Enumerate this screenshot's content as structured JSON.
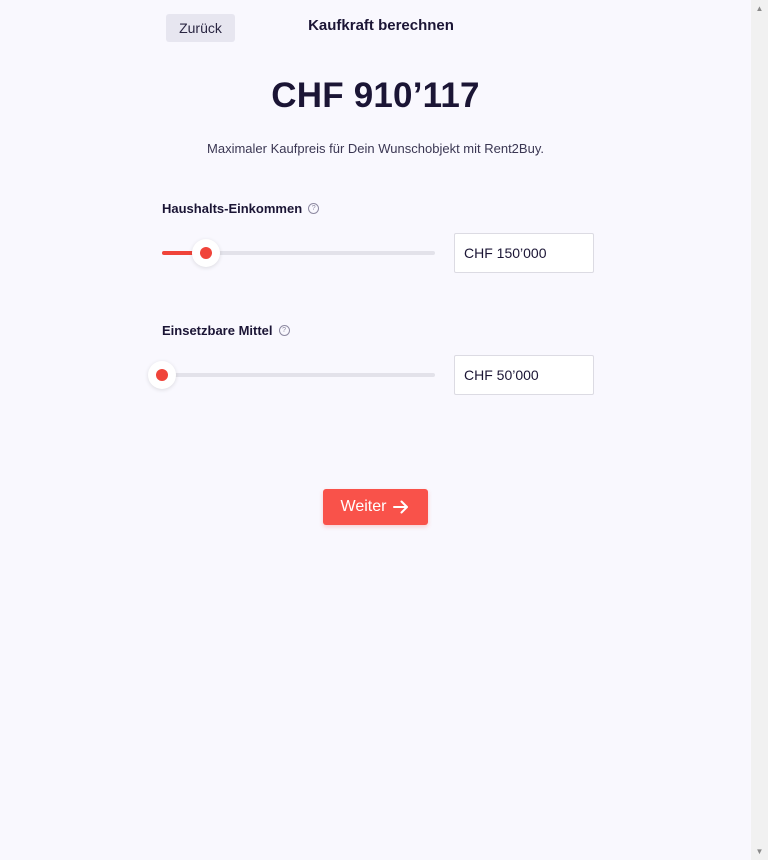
{
  "header": {
    "back_label": "Zurück",
    "title": "Kaufkraft berechnen"
  },
  "result": {
    "amount": "CHF 910’117",
    "description": "Maximaler Kaufpreis für Dein Wunschobjekt mit Rent2Buy."
  },
  "fields": [
    {
      "label": "Haushalts-Einkommen",
      "help_icon": "question-circle-icon",
      "slider_fraction": 0.16,
      "value": "CHF 150’000"
    },
    {
      "label": "Einsetzbare Mittel",
      "help_icon": "question-circle-icon",
      "slider_fraction": 0.0,
      "value": "CHF 50’000"
    }
  ],
  "actions": {
    "next_label": "Weiter",
    "next_icon": "arrow-right-icon"
  },
  "colors": {
    "accent": "#f0443a",
    "button": "#f9524a",
    "text": "#1b1535",
    "background": "#f9f8fe"
  }
}
